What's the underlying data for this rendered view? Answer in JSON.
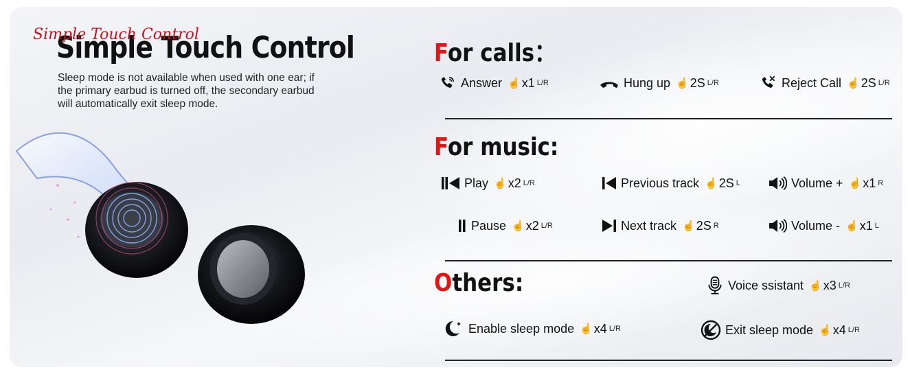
{
  "header": {
    "script_title": "Simple Touch Control",
    "title": "Simple Touch Control",
    "description": "Sleep mode is not available when used with one ear; if the primary earbud is turned off, the secondary earbud will automatically exit sleep mode."
  },
  "sections": {
    "calls": {
      "first_letter": "F",
      "rest": "or calls：",
      "items": [
        {
          "icon": "phone-answer-icon",
          "label": "Answer",
          "tap_icon": "tap-hand-icon",
          "count": "x1",
          "side": "L/R"
        },
        {
          "icon": "hang-up-icon",
          "label": "Hung up",
          "tap_icon": "tap-hand-icon",
          "count": "2S",
          "side": "L/R"
        },
        {
          "icon": "reject-call-icon",
          "label": "Reject Call",
          "tap_icon": "tap-hand-icon",
          "count": "2S",
          "side": "L/R"
        }
      ]
    },
    "music": {
      "first_letter": "F",
      "rest": "or music:",
      "items": [
        {
          "icon": "play-icon",
          "label": "Play",
          "tap_icon": "tap-hand-icon",
          "count": "x2",
          "side": "L/R"
        },
        {
          "icon": "previous-track-icon",
          "label": "Previous track",
          "tap_icon": "tap-hand-icon",
          "count": "2S",
          "side": "L"
        },
        {
          "icon": "volume-up-icon",
          "label": "Volume +",
          "tap_icon": "tap-hand-icon",
          "count": "x1",
          "side": "R"
        },
        {
          "icon": "pause-icon",
          "label": "Pause",
          "tap_icon": "tap-hand-icon",
          "count": "x2",
          "side": "L/R"
        },
        {
          "icon": "next-track-icon",
          "label": "Next track",
          "tap_icon": "tap-hand-icon",
          "count": "2S",
          "side": "R"
        },
        {
          "icon": "volume-down-icon",
          "label": "Volume -",
          "tap_icon": "tap-hand-icon",
          "count": "x1",
          "side": "L"
        }
      ]
    },
    "others": {
      "first_letter": "O",
      "rest": "thers:",
      "items": [
        {
          "icon": "microphone-icon",
          "label": "Voice ssistant",
          "tap_icon": "tap-hand-icon",
          "count": "x3",
          "side": "L/R"
        },
        {
          "icon": "moon-icon",
          "label": "Enable sleep mode",
          "tap_icon": "tap-hand-icon",
          "count": "x4",
          "side": "L/R"
        },
        {
          "icon": "exit-sleep-icon",
          "label": "Exit sleep mode",
          "tap_icon": "tap-hand-icon",
          "count": "x4",
          "side": "L/R"
        }
      ]
    }
  },
  "colors": {
    "accent": "#e31414",
    "text": "#111111",
    "background": "#eef0f4"
  }
}
